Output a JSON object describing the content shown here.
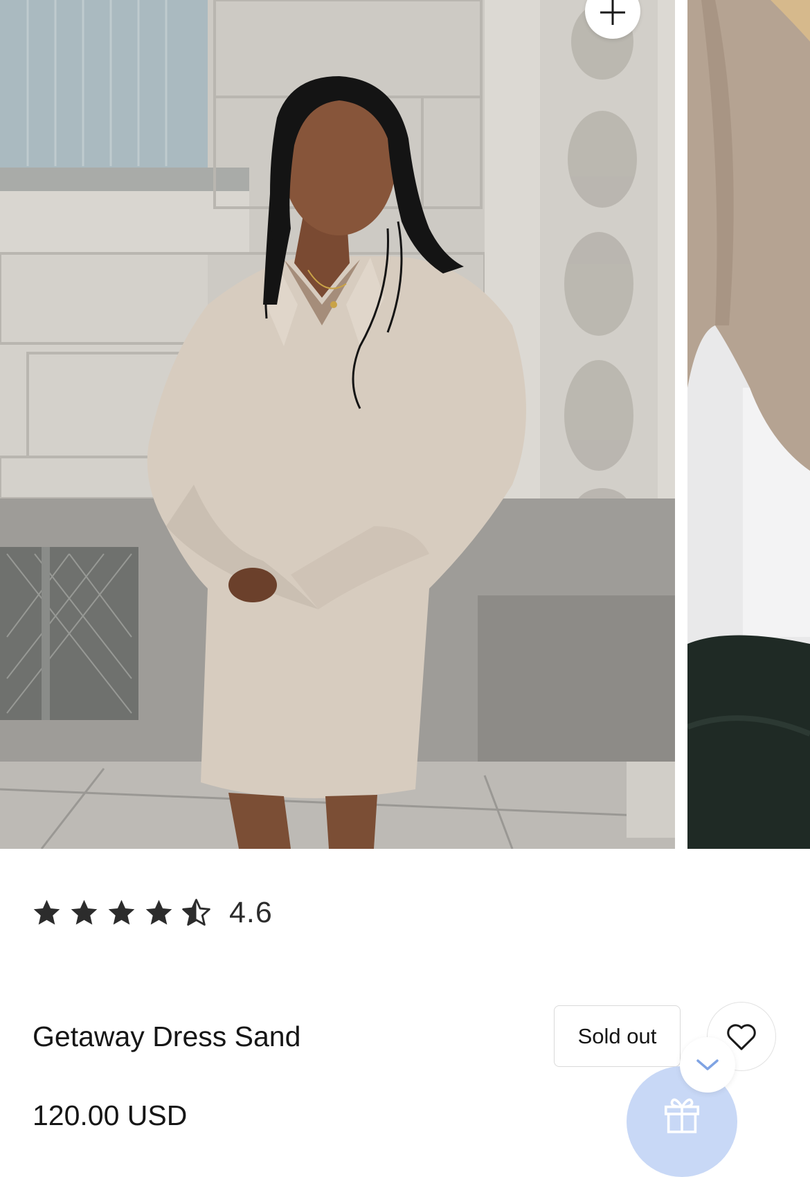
{
  "gallery": {
    "images": [
      {
        "alt": "Getaway Dress Sand"
      },
      {
        "alt": "Getaway Dress Sand"
      }
    ],
    "zoom_icon": "plus-icon"
  },
  "rating": {
    "value": "4.6",
    "stars_filled": 4.5,
    "stars_total": 5,
    "icon": "star-icon"
  },
  "product": {
    "title": "Getaway Dress Sand",
    "price": "120.00 USD",
    "status_button": "Sold out",
    "wishlist_icon": "heart-icon"
  },
  "widgets": {
    "gift_icon": "gift-icon",
    "collapse_icon": "chevron-down-icon",
    "gift_color": "#c8d8f6"
  },
  "colors": {
    "text": "#161616",
    "star": "#2c2c2c"
  }
}
